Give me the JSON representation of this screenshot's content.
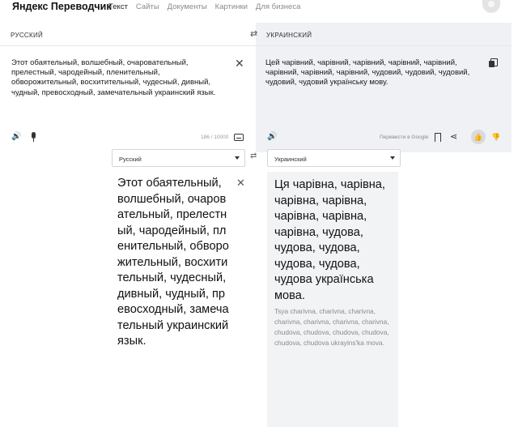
{
  "header": {
    "logo": "Яндекс Переводчик",
    "nav": [
      "Текст",
      "Сайты",
      "Документы",
      "Картинки",
      "Для бизнеса"
    ]
  },
  "source": {
    "language": "РУССКИЙ",
    "text": "Этот обаятельный, волшебный, очаровательный, прелестный, чародейный, пленительный, обворожительный, восхитительный, чудесный, дивный, чудный, превосходный, замечательный украинский язык.",
    "counter": "186 / 10000"
  },
  "target": {
    "language": "УКРАИНСКИЙ",
    "text": "Цей чарівний, чарівний, чарівний, чарівний, чарівний, чарівний, чарівний, чарівний, чудовий, чудовий, чудовий, чудовий, чудовий українську мову.",
    "translate_with": "Перевести в Google"
  },
  "mobile": {
    "source_select": "Русский",
    "target_select": "Украинский",
    "source_text": "Этот обаятельный, волшебный, очаровательный, прелестный, чародейный, пленительный, обворожительный, восхитительный, чудесный, дивный, чудный, превосходный, замечательный украинский язык.",
    "target_text": "Ця чарівна, чарівна, чарівна, чарівна, чарівна, чарівна, чарівна, чудова, чудова, чудова, чудова, чудова, чудова українська мова.",
    "transliteration": "Tsya charivna, charivna, charivna, charivna, charivna, charivna, charivna, chudova, chudova, chudova, chudova, chudova, chudova ukrayins'ka mova."
  },
  "icons": {
    "swap": "swap-arrows-icon",
    "close": "close-icon",
    "speaker": "speaker-icon",
    "mic": "microphone-icon",
    "keyboard": "keyboard-icon",
    "copy": "copy-icon",
    "bookmark": "bookmark-icon",
    "share": "share-icon",
    "thumb_up": "thumbs-up-icon",
    "thumb_down": "thumbs-down-icon"
  },
  "colors": {
    "target_panel": "#eff1f4",
    "accent_text": "#111111",
    "muted_text": "#8a8a8a"
  }
}
